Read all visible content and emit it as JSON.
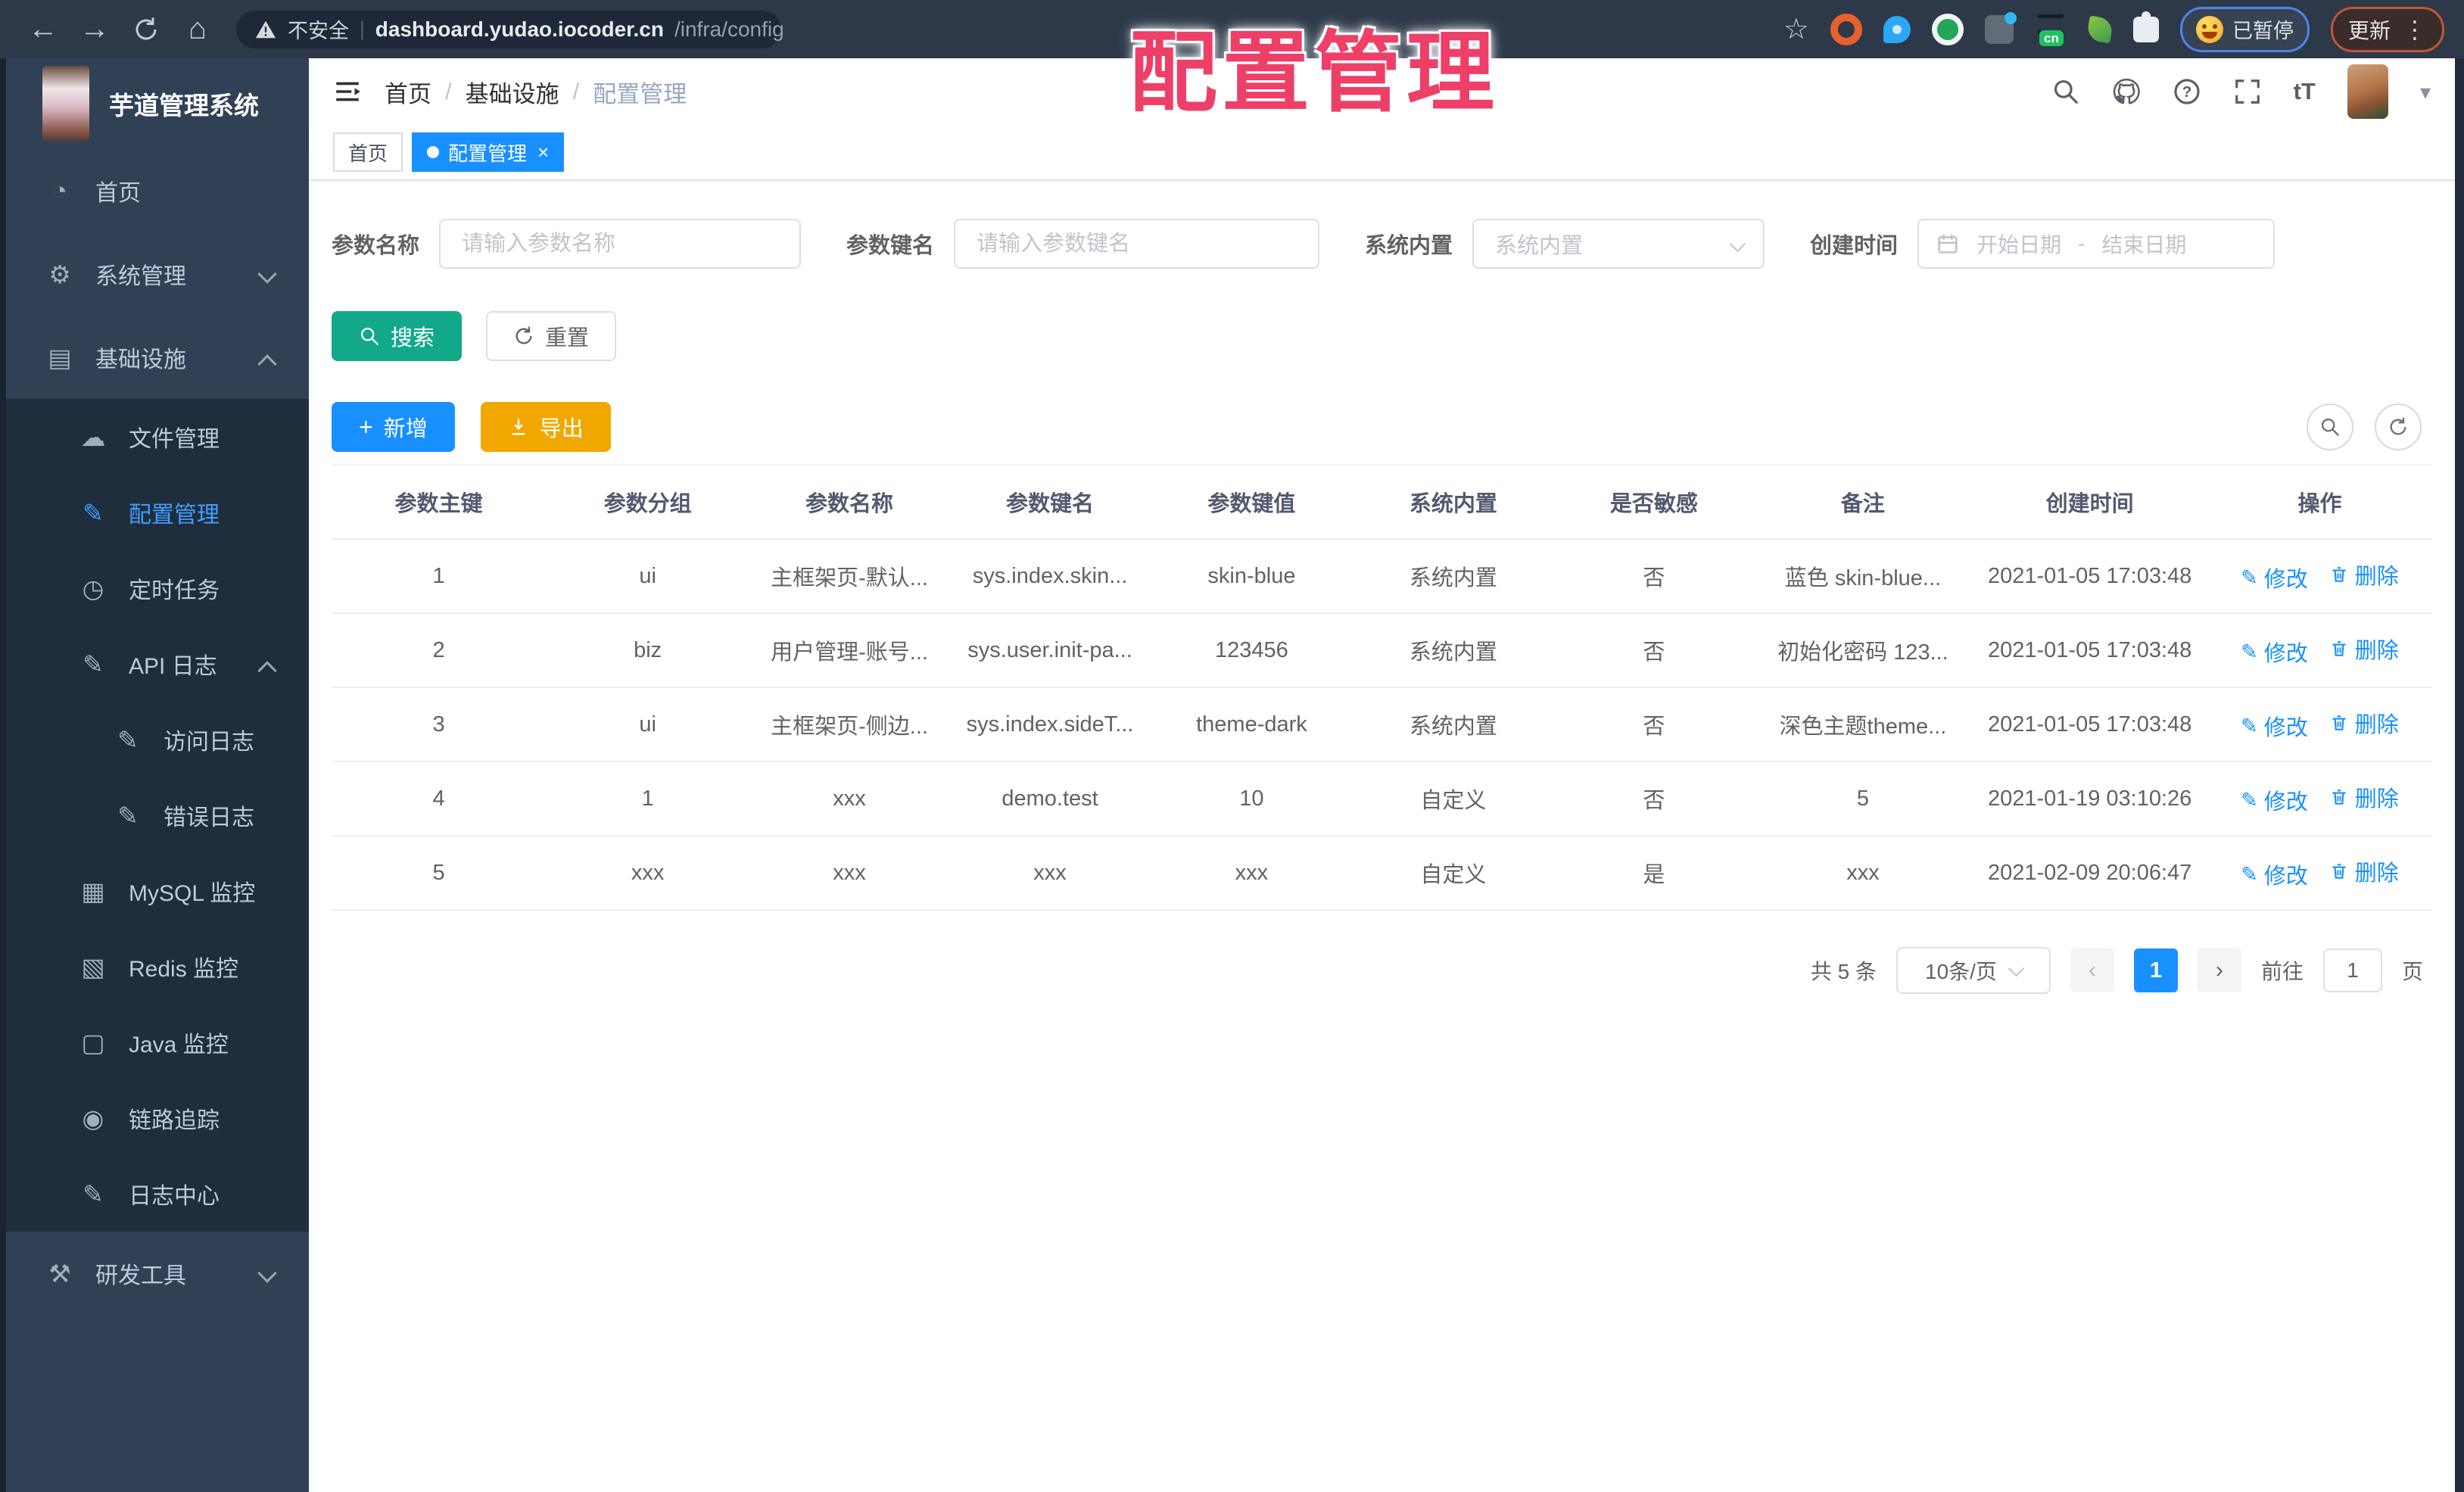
{
  "browser": {
    "security_label": "不安全",
    "url_host": "dashboard.yudao.iocoder.cn",
    "url_path": "/infra/config",
    "cn_badge": "cn",
    "paused_badge": "已暂停",
    "update_button": "更新"
  },
  "overlay": {
    "title": "配置管理"
  },
  "icons": {
    "back": "←",
    "forward": "→",
    "home": "⌂",
    "star": "☆",
    "kebab": "⋮",
    "caret_down": "▾",
    "sep": "|",
    "close": "×",
    "font_size": "tT",
    "pencil": "✎",
    "prev": "‹",
    "next": "›"
  },
  "sidebar_glyphs": {
    "dashboard": "◔",
    "gear": "⚙",
    "infra": "▤",
    "cloud": "☁",
    "edit": "✎",
    "clock": "◷",
    "monitor": "▦",
    "layers": "▧",
    "screen": "▢",
    "eye": "◉",
    "hammer": "⚒"
  },
  "app": {
    "logo_title": "芋道管理系统",
    "breadcrumb": [
      "首页",
      "基础设施",
      "配置管理"
    ],
    "tags": [
      {
        "label": "首页",
        "active": false,
        "closable": false
      },
      {
        "label": "配置管理",
        "active": true,
        "closable": true
      }
    ]
  },
  "sidebar": {
    "items": [
      {
        "id": "home",
        "label": "首页",
        "glyph": "dashboard",
        "icon": "dashboard-icon",
        "level": 0
      },
      {
        "id": "system",
        "label": "系统管理",
        "glyph": "gear",
        "icon": "gear-icon",
        "level": 0,
        "chevron": "down"
      },
      {
        "id": "infra",
        "label": "基础设施",
        "glyph": "infra",
        "icon": "infrastructure-icon",
        "level": 0,
        "chevron": "up"
      },
      {
        "id": "file",
        "label": "文件管理",
        "glyph": "cloud",
        "icon": "cloud-upload-icon",
        "level": 1
      },
      {
        "id": "config",
        "label": "配置管理",
        "glyph": "edit",
        "icon": "edit-icon",
        "level": 1,
        "active": true
      },
      {
        "id": "job",
        "label": "定时任务",
        "glyph": "clock",
        "icon": "schedule-icon",
        "level": 1
      },
      {
        "id": "api-log",
        "label": "API 日志",
        "glyph": "edit",
        "icon": "log-icon",
        "level": 1,
        "chevron": "up"
      },
      {
        "id": "access-log",
        "label": "访问日志",
        "glyph": "edit",
        "icon": "log-icon",
        "level": 2
      },
      {
        "id": "error-log",
        "label": "错误日志",
        "glyph": "edit",
        "icon": "log-icon",
        "level": 2
      },
      {
        "id": "mysql",
        "label": "MySQL 监控",
        "glyph": "monitor",
        "icon": "mysql-monitor-icon",
        "level": 1
      },
      {
        "id": "redis",
        "label": "Redis 监控",
        "glyph": "layers",
        "icon": "redis-monitor-icon",
        "level": 1
      },
      {
        "id": "java",
        "label": "Java 监控",
        "glyph": "screen",
        "icon": "java-monitor-icon",
        "level": 1
      },
      {
        "id": "trace",
        "label": "链路追踪",
        "glyph": "eye",
        "icon": "trace-icon",
        "level": 1
      },
      {
        "id": "log-center",
        "label": "日志中心",
        "glyph": "edit",
        "icon": "log-icon",
        "level": 1
      },
      {
        "id": "dev-tools",
        "label": "研发工具",
        "glyph": "hammer",
        "icon": "tools-icon",
        "level": 0,
        "chevron": "down"
      }
    ]
  },
  "filters": {
    "name": {
      "label": "参数名称",
      "placeholder": "请输入参数名称",
      "value": ""
    },
    "key": {
      "label": "参数键名",
      "placeholder": "请输入参数键名",
      "value": ""
    },
    "type": {
      "label": "系统内置",
      "placeholder": "系统内置"
    },
    "create_time": {
      "label": "创建时间",
      "start_placeholder": "开始日期",
      "separator": "-",
      "end_placeholder": "结束日期"
    }
  },
  "actions": {
    "search": "搜索",
    "reset": "重置",
    "add": "新增",
    "export": "导出"
  },
  "table": {
    "columns": [
      "参数主键",
      "参数分组",
      "参数名称",
      "参数键名",
      "参数键值",
      "系统内置",
      "是否敏感",
      "备注",
      "创建时间",
      "操作"
    ],
    "col_widths": [
      10.2,
      9.7,
      9.5,
      9.6,
      9.6,
      9.6,
      9.5,
      10.4,
      11.2,
      10.7
    ],
    "rows": [
      {
        "id": "1",
        "group": "ui",
        "name": "主框架页-默认...",
        "key": "sys.index.skin...",
        "value": "skin-blue",
        "type": "系统内置",
        "sensitive": "否",
        "remark": "蓝色 skin-blue...",
        "created": "2021-01-05 17:03:48"
      },
      {
        "id": "2",
        "group": "biz",
        "name": "用户管理-账号...",
        "key": "sys.user.init-pa...",
        "value": "123456",
        "type": "系统内置",
        "sensitive": "否",
        "remark": "初始化密码 123...",
        "created": "2021-01-05 17:03:48"
      },
      {
        "id": "3",
        "group": "ui",
        "name": "主框架页-侧边...",
        "key": "sys.index.sideT...",
        "value": "theme-dark",
        "type": "系统内置",
        "sensitive": "否",
        "remark": "深色主题theme...",
        "created": "2021-01-05 17:03:48"
      },
      {
        "id": "4",
        "group": "1",
        "name": "xxx",
        "key": "demo.test",
        "value": "10",
        "type": "自定义",
        "sensitive": "否",
        "remark": "5",
        "created": "2021-01-19 03:10:26"
      },
      {
        "id": "5",
        "group": "xxx",
        "name": "xxx",
        "key": "xxx",
        "value": "xxx",
        "type": "自定义",
        "sensitive": "是",
        "remark": "xxx",
        "created": "2021-02-09 20:06:47"
      }
    ],
    "row_actions": {
      "edit": "修改",
      "delete": "删除"
    }
  },
  "pagination": {
    "total": "共 5 条",
    "page_size": "10条/页",
    "current_page": "1",
    "goto_label": "前往",
    "goto_value": "1",
    "page_suffix": "页"
  },
  "colors": {
    "primary": "#1890ff",
    "search_button": "#12a88a",
    "export_button": "#f0a800",
    "sidebar_bg": "#304156",
    "submenu_bg": "#1f2d3d",
    "active_menu_text": "#409eff",
    "overlay_text": "#ee3f68",
    "link": "#1890ff"
  }
}
